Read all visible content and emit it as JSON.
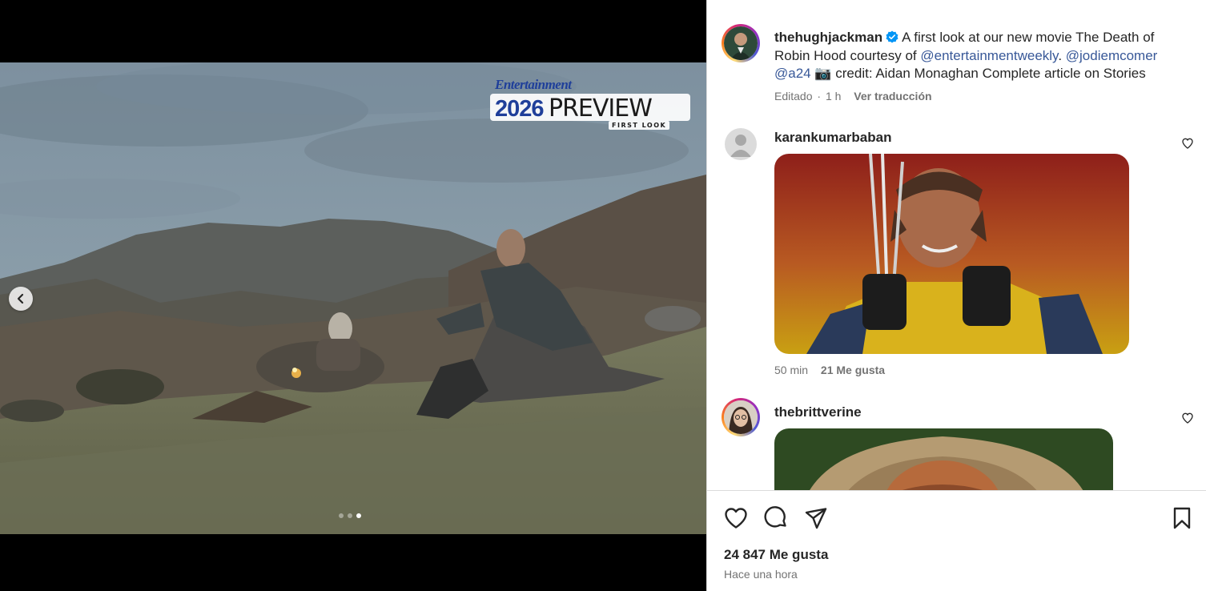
{
  "post": {
    "author": "thehughjackman",
    "caption_intro": "A first look at our new movie The Death of Robin Hood courtesy of ",
    "mention_1": "@entertainmentweekly",
    "caption_dot": ". ",
    "mention_2": "@jodiemcomer",
    "mention_3": "@a24",
    "camera_emoji": "📷",
    "caption_tail": " credit: Aidan Monaghan Complete article on Stories",
    "edited": "Editado",
    "dot_sep": "·",
    "time": "1 h",
    "translate": "Ver traducción"
  },
  "media": {
    "badge_brand": "Entertainment",
    "badge_year": "2026",
    "badge_word": "PREVIEW",
    "badge_sub": "FIRST LOOK",
    "carousel_index": 3,
    "carousel_total": 3
  },
  "comments": [
    {
      "user": "karankumarbaban",
      "time": "50 min",
      "likes": "21 Me gusta"
    },
    {
      "user": "thebrittverine"
    }
  ],
  "footer": {
    "likes": "24 847 Me gusta",
    "posted": "Hace una hora"
  },
  "icons": [
    "chevron-left-icon",
    "verified-icon",
    "heart-icon",
    "comment-icon",
    "share-icon",
    "bookmark-icon"
  ],
  "colors": {
    "link": "#385898",
    "verified": "#0095f6",
    "muted": "#737373",
    "text": "#262626"
  }
}
